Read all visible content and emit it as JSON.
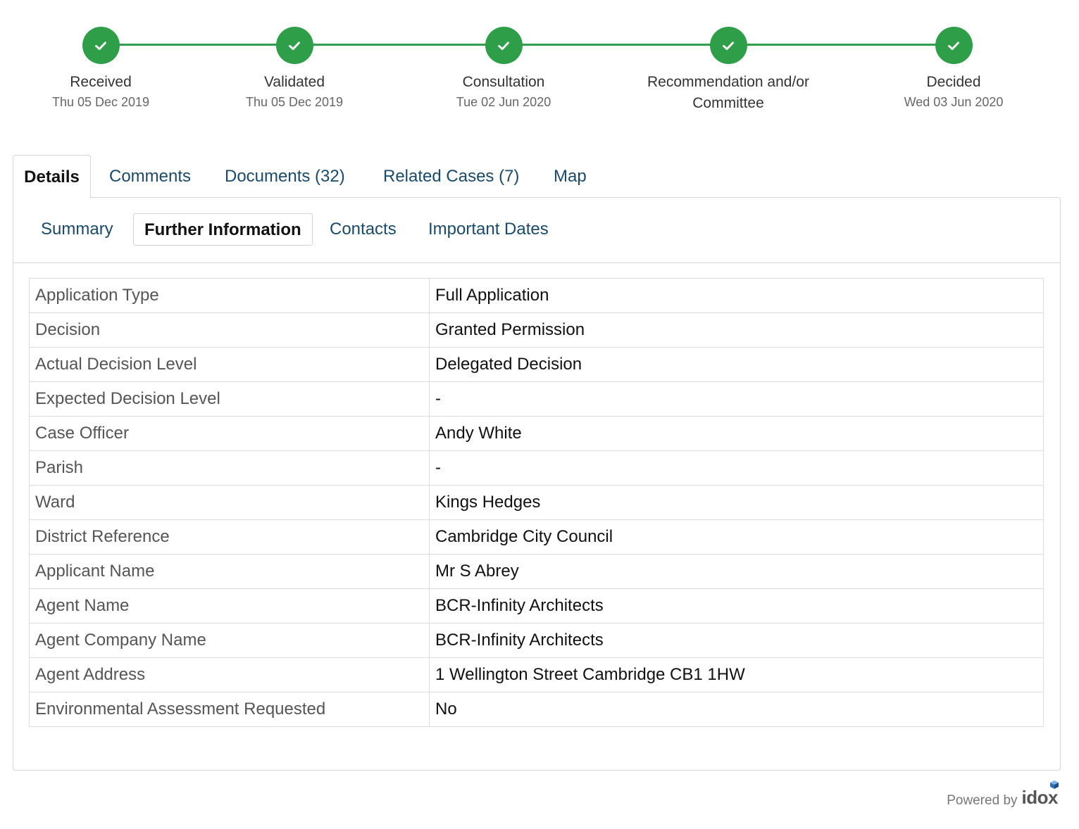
{
  "progress": {
    "steps": [
      {
        "label": "Received",
        "date": "Thu 05 Dec 2019"
      },
      {
        "label": "Validated",
        "date": "Thu 05 Dec 2019"
      },
      {
        "label": "Consultation",
        "date": "Tue 02 Jun 2020"
      },
      {
        "label": "Recommendation and/or Committee",
        "date": ""
      },
      {
        "label": "Decided",
        "date": "Wed 03 Jun 2020"
      }
    ],
    "complete_color": "#2e9e48"
  },
  "main_tabs": [
    "Details",
    "Comments",
    "Documents (32)",
    "Related Cases (7)",
    "Map"
  ],
  "sub_tabs": [
    "Summary",
    "Further Information",
    "Contacts",
    "Important Dates"
  ],
  "details": [
    {
      "key": "Application Type",
      "value": "Full Application"
    },
    {
      "key": "Decision",
      "value": "Granted Permission"
    },
    {
      "key": "Actual Decision Level",
      "value": "Delegated Decision"
    },
    {
      "key": "Expected Decision Level",
      "value": "-"
    },
    {
      "key": "Case Officer",
      "value": "Andy White"
    },
    {
      "key": "Parish",
      "value": "-"
    },
    {
      "key": "Ward",
      "value": "Kings Hedges"
    },
    {
      "key": "District Reference",
      "value": "Cambridge City Council"
    },
    {
      "key": "Applicant Name",
      "value": "Mr S Abrey"
    },
    {
      "key": "Agent Name",
      "value": "BCR-Infinity Architects"
    },
    {
      "key": "Agent Company Name",
      "value": "BCR-Infinity Architects"
    },
    {
      "key": "Agent Address",
      "value": "1 Wellington Street Cambridge CB1 1HW"
    },
    {
      "key": "Environmental Assessment Requested",
      "value": "No"
    }
  ],
  "footer": {
    "powered_by": "Powered by",
    "brand": "idox"
  }
}
